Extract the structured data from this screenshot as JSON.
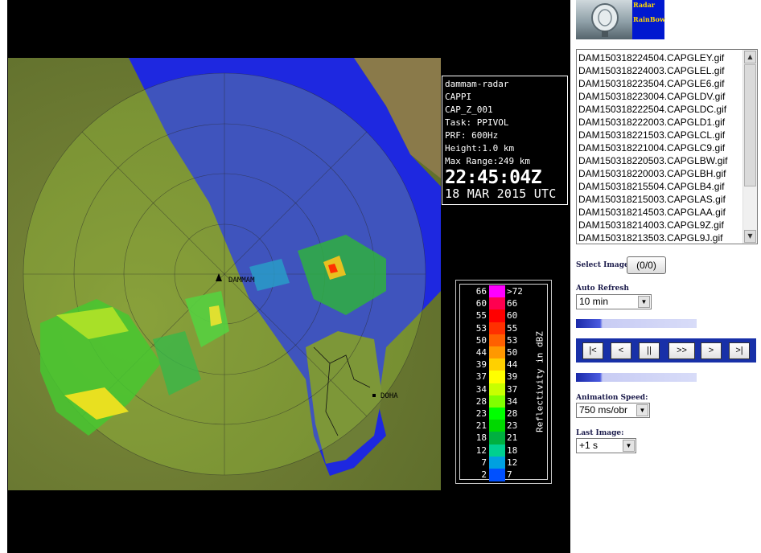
{
  "radar_info": {
    "site": "dammam-radar",
    "product": "CAPPI",
    "product_code": "CAP_Z_001",
    "task": "Task: PPIVOL",
    "prf": "PRF: 600Hz",
    "height": "Height:1.0 km",
    "max_range": "Max Range:249 km",
    "time": "22:45:04Z",
    "date": "18 MAR 2015 UTC"
  },
  "map_labels": {
    "station": "DAMMAM",
    "city": "DOHA"
  },
  "legend": {
    "unit": "Reflectivity in dBZ",
    "rows": [
      {
        "lo": "66",
        "hi": ">72",
        "color": "#ff00ff"
      },
      {
        "lo": "60",
        "hi": "66",
        "color": "#ff0050"
      },
      {
        "lo": "55",
        "hi": "60",
        "color": "#ff0000"
      },
      {
        "lo": "53",
        "hi": "55",
        "color": "#ff3000"
      },
      {
        "lo": "50",
        "hi": "53",
        "color": "#ff6000"
      },
      {
        "lo": "44",
        "hi": "50",
        "color": "#ff9800"
      },
      {
        "lo": "39",
        "hi": "44",
        "color": "#ffd000"
      },
      {
        "lo": "37",
        "hi": "39",
        "color": "#ffff00"
      },
      {
        "lo": "34",
        "hi": "37",
        "color": "#c8ff00"
      },
      {
        "lo": "28",
        "hi": "34",
        "color": "#80ff00"
      },
      {
        "lo": "23",
        "hi": "28",
        "color": "#00ff00"
      },
      {
        "lo": "21",
        "hi": "23",
        "color": "#00d800"
      },
      {
        "lo": "18",
        "hi": "21",
        "color": "#00b040"
      },
      {
        "lo": "12",
        "hi": "18",
        "color": "#00d090"
      },
      {
        "lo": "7",
        "hi": "12",
        "color": "#00a0e0"
      },
      {
        "lo": "2",
        "hi": "7",
        "color": "#0050ff"
      }
    ]
  },
  "logo": {
    "line1": "Radar",
    "line2": "RainBow"
  },
  "files": [
    "DAM150318224504.CAPGLEY.gif",
    "DAM150318224003.CAPGLEL.gif",
    "DAM150318223504.CAPGLE6.gif",
    "DAM150318223004.CAPGLDV.gif",
    "DAM150318222504.CAPGLDC.gif",
    "DAM150318222003.CAPGLD1.gif",
    "DAM150318221503.CAPGLCL.gif",
    "DAM150318221004.CAPGLC9.gif",
    "DAM150318220503.CAPGLBW.gif",
    "DAM150318220003.CAPGLBH.gif",
    "DAM150318215504.CAPGLB4.gif",
    "DAM150318215003.CAPGLAS.gif",
    "DAM150318214503.CAPGLAA.gif",
    "DAM150318214003.CAPGL9Z.gif",
    "DAM150318213503.CAPGL9J.gif"
  ],
  "controls": {
    "select_images_label": "Select Images:",
    "select_images_button": "(0/0)",
    "auto_refresh_label": "Auto Refresh",
    "auto_refresh_value": "10 min",
    "animation_speed_label": "Animation Speed:",
    "animation_speed_value": "750 ms/obr",
    "last_image_label": "Last Image:",
    "last_image_value": "+1 s",
    "nav": {
      "first": "|<",
      "prev": "<",
      "pause": "||",
      "play": ">>",
      "next": ">",
      "last": ">|"
    }
  },
  "colors": {
    "water": "#1e28e0",
    "land": "#6f7f34",
    "nav_bar": "#1830a8"
  }
}
